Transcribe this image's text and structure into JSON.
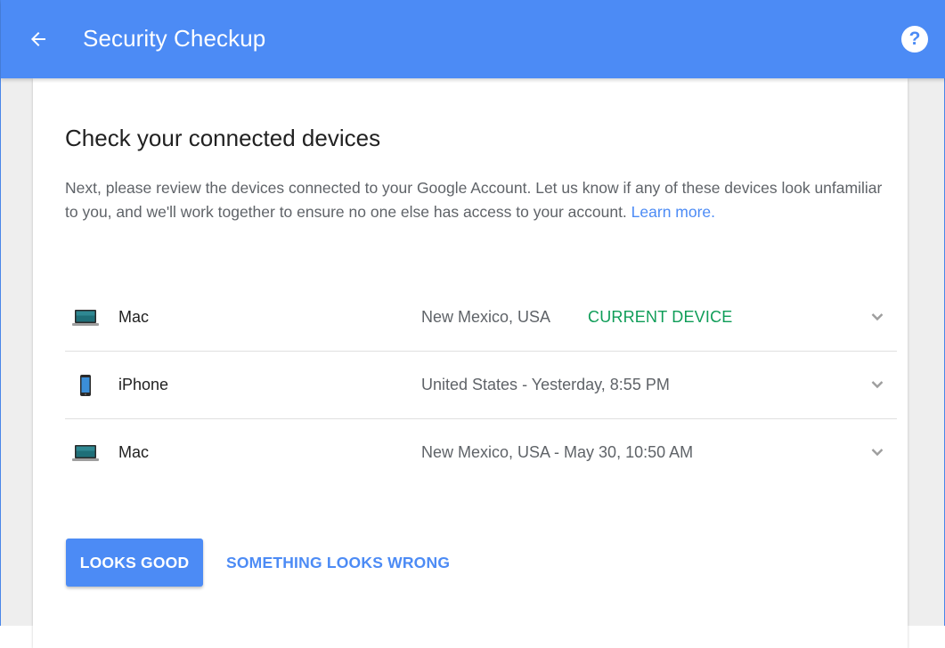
{
  "appbar": {
    "title": "Security Checkup",
    "back_icon": "arrow-back-icon",
    "help_icon": "help-icon",
    "help_glyph": "?",
    "color": "#4c8bf5"
  },
  "content": {
    "heading": "Check your connected devices",
    "description": "Next, please review the devices connected to your Google Account. Let us know if any of these devices look unfamiliar to you, and we'll work together to ensure no one else has access to your account.",
    "learn_more": "Learn more."
  },
  "devices": [
    {
      "icon": "laptop-icon",
      "name": "Mac",
      "meta": "New Mexico, USA",
      "badge": "CURRENT DEVICE"
    },
    {
      "icon": "phone-icon",
      "name": "iPhone",
      "meta": "United States - Yesterday, 8:55 PM",
      "badge": ""
    },
    {
      "icon": "laptop-icon",
      "name": "Mac",
      "meta": "New Mexico, USA - May 30, 10:50 AM",
      "badge": ""
    }
  ],
  "actions": {
    "primary": "LOOKS GOOD",
    "secondary": "SOMETHING LOOKS WRONG"
  },
  "colors": {
    "accent": "#4c8bf5",
    "current_device": "#0f9d58"
  }
}
